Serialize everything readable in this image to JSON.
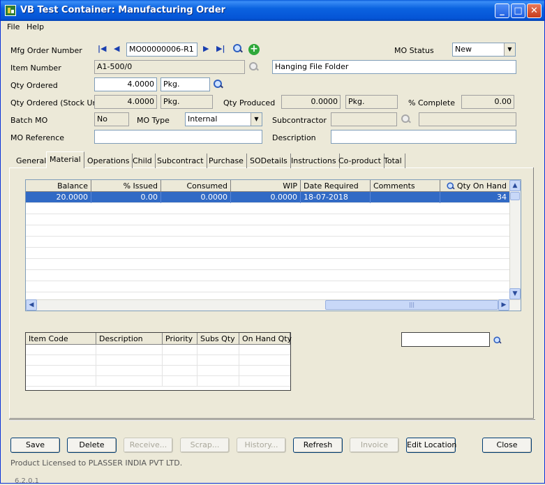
{
  "window": {
    "title": "VB Test Container: Manufacturing Order",
    "minimize_glyph": "_",
    "maximize_glyph": "□",
    "close_glyph": "✕"
  },
  "menu": {
    "file": "File",
    "help": "Help"
  },
  "form": {
    "mfg_order_number_label": "Mfg Order Number",
    "mfg_order_number": "MO00000006-R1",
    "mo_status_label": "MO Status",
    "mo_status": "New",
    "item_number_label": "Item Number",
    "item_number": "A1-500/0",
    "item_description": "Hanging File Folder",
    "qty_ordered_label": "Qty Ordered",
    "qty_ordered": "4.0000",
    "qty_ordered_unit": "Pkg.",
    "qty_ordered_stock_label": "Qty Ordered (Stock Unit)",
    "qty_ordered_stock": "4.0000",
    "qty_ordered_stock_unit": "Pkg.",
    "qty_produced_label": "Qty Produced",
    "qty_produced": "0.0000",
    "qty_produced_unit": "Pkg.",
    "pct_complete_label": "% Complete",
    "pct_complete": "0.00",
    "batch_mo_label": "Batch MO",
    "batch_mo": "No",
    "mo_type_label": "MO Type",
    "mo_type": "Internal",
    "subcontractor_label": "Subcontractor",
    "subcontractor": "",
    "subcontractor_name": "",
    "mo_reference_label": "MO Reference",
    "mo_reference": "",
    "description_label": "Description",
    "description": ""
  },
  "tabs": [
    {
      "label": "General"
    },
    {
      "label": "Material"
    },
    {
      "label": "Operations"
    },
    {
      "label": "Child"
    },
    {
      "label": "Subcontract"
    },
    {
      "label": "Purchase"
    },
    {
      "label": "SODetails"
    },
    {
      "label": "Instructions"
    },
    {
      "label": "Co-product"
    },
    {
      "label": "Total"
    }
  ],
  "material_grid": {
    "columns": [
      "Balance",
      "% Issued",
      "Consumed",
      "WIP",
      "Date Required",
      "Comments",
      "Qty On Hand"
    ],
    "rows": [
      {
        "balance": "20.0000",
        "issued": "0.00",
        "consumed": "0.0000",
        "wip": "0.0000",
        "date_required": "18-07-2018",
        "comments": "",
        "qty_on_hand": "34"
      }
    ],
    "scroll_mark": "|||"
  },
  "subs_grid": {
    "columns": [
      "Item Code",
      "Description",
      "Priority",
      "Subs Qty",
      "On Hand Qty"
    ]
  },
  "search_box": {
    "value": ""
  },
  "buttons": {
    "save": "Save",
    "delete": "Delete",
    "receive": "Receive...",
    "scrap": "Scrap...",
    "history": "History...",
    "refresh": "Refresh",
    "invoice": "Invoice",
    "edit_location": "Edit Location",
    "close": "Close"
  },
  "footer": {
    "license": "Product Licensed to PLASSER INDIA PVT LTD.",
    "version": "6.2.0.1"
  }
}
